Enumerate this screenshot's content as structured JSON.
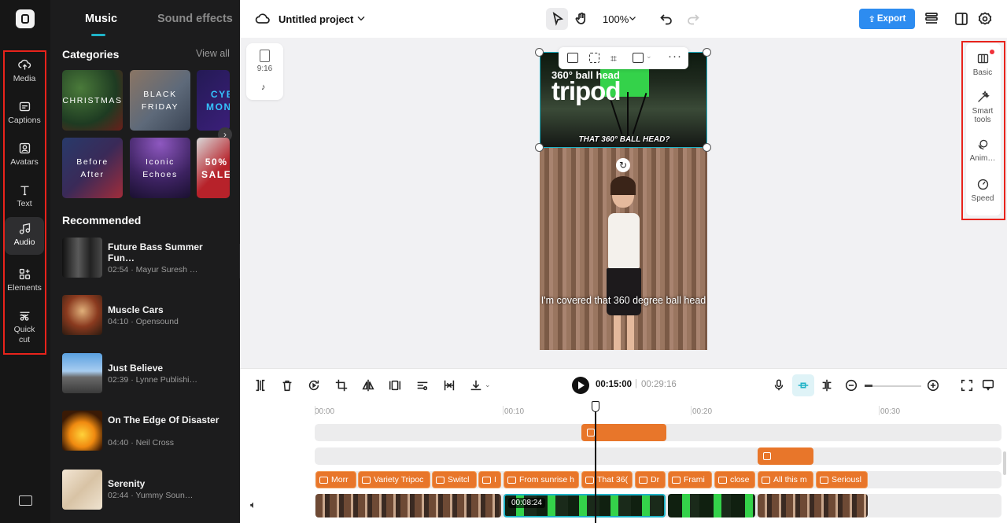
{
  "sidebar": {
    "items": [
      {
        "label": "Media",
        "icon": "upload-cloud-icon"
      },
      {
        "label": "Captions",
        "icon": "captions-icon"
      },
      {
        "label": "Avatars",
        "icon": "avatar-icon"
      },
      {
        "label": "Text",
        "icon": "text-icon"
      },
      {
        "label": "Audio",
        "icon": "music-note-icon"
      },
      {
        "label": "Elements",
        "icon": "elements-icon"
      },
      {
        "label": "Quick\ncut",
        "icon": "quick-cut-icon"
      }
    ],
    "active": "Audio"
  },
  "panel": {
    "tabs": [
      "Music",
      "Sound effects"
    ],
    "categories_title": "Categories",
    "view_all": "View all",
    "categories": [
      "CHRISTMAS",
      "BLACK\nFRIDAY",
      "CYBER\nMONDAY",
      "Before\nAfter",
      "Iconic\nEchoes",
      "50%\nSALE"
    ],
    "recommended_title": "Recommended",
    "tracks": [
      {
        "title": "Future Bass Summer Fun…",
        "meta": "02:54 · Mayur Suresh …"
      },
      {
        "title": "Muscle Cars",
        "meta": "04:10 · Opensound"
      },
      {
        "title": "Just Believe",
        "meta": "02:39 · Lynne Publishi…"
      },
      {
        "title": "On The Edge Of Disaster",
        "meta": "04:40 · Neil Cross"
      },
      {
        "title": "Serenity",
        "meta": "02:44 · Yummy Soun…"
      }
    ]
  },
  "topbar": {
    "project_name": "Untitled project",
    "zoom": "100%",
    "export_label": "Export"
  },
  "canvas": {
    "ratio": "9:16",
    "video_text_big": "tripod",
    "video_text_small": "360° ball head",
    "video_subtitle_top": "THAT 360° BALL HEAD?",
    "caption": "I'm covered that 360 degree ball head"
  },
  "right_panel": {
    "items": [
      "Basic",
      "Smart tools",
      "Anim…",
      "Speed"
    ]
  },
  "timeline": {
    "current_time": "00:15:00",
    "total_time": "00:29:16",
    "ruler": [
      "00:00",
      "00:10",
      "00:20",
      "00:30"
    ],
    "captions": [
      "Morr",
      "Variety Tripoc",
      "Switcl",
      "I",
      "From sunrise h",
      "That 36(",
      "Dr",
      "Frami",
      "close",
      "All this m",
      "Seriousl"
    ],
    "clip_time": "00:08:24"
  },
  "colors": {
    "accent": "#1fb3c7",
    "export_button": "#2d8cf0",
    "caption_clip": "#e8762a",
    "highlight_box": "#e8231b"
  }
}
